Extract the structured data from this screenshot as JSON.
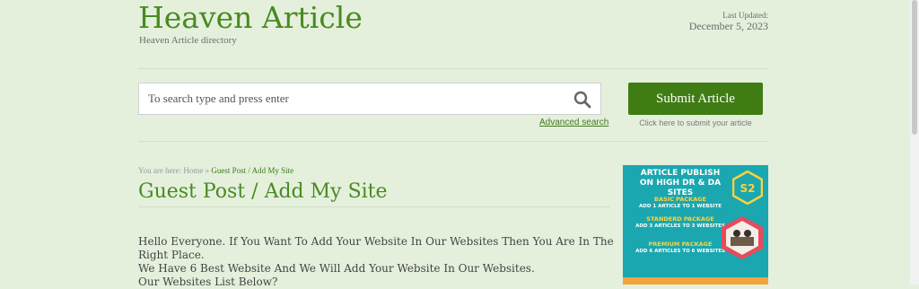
{
  "header": {
    "site_title": "Heaven Article",
    "tagline": "Heaven Article directory",
    "last_updated_label": "Last Updated:",
    "last_updated_date": "December 5, 2023"
  },
  "search": {
    "placeholder": "To search type and press enter",
    "advanced_link": "Advanced search",
    "icon": "search-icon"
  },
  "submit": {
    "button_label": "Submit Article",
    "caption": "Click here to submit your article"
  },
  "breadcrumb": {
    "prefix": "You are here:",
    "home": "Home",
    "separator": "»",
    "current": "Guest Post / Add My Site"
  },
  "page": {
    "title": "Guest Post / Add My Site",
    "paragraph_lines": [
      "Hello Everyone. If You Want To Add Your Website In Our Websites Then You Are In The Right Place.",
      "We Have 6 Best Website And We Will Add Your Website In Our Websites.",
      "Our Websites List Below?"
    ]
  },
  "ad": {
    "headline_1": "ARTICLE PUBLISH",
    "headline_2": "ON HIGH DR & DA SITES",
    "packages": [
      {
        "name": "BASIC PACKAGE",
        "desc": "ADD 1 ARTICLE TO 1 WEBSITE"
      },
      {
        "name": "STANDERD PACKAGE",
        "desc": "ADD 3 ARTICLES TO 3 WEBSITES"
      },
      {
        "name": "PREMIUM PACKAGE",
        "desc": "ADD 6 ARTICLES TO 6 WEBSITES"
      }
    ],
    "colors": {
      "background": "#1aa7b0",
      "accent": "#ffd23d",
      "bottom": "#f2a43a"
    }
  },
  "colors": {
    "brand_green": "#4a8a22",
    "button_green": "#3f7c14",
    "page_bg": "#e4f0dc"
  }
}
